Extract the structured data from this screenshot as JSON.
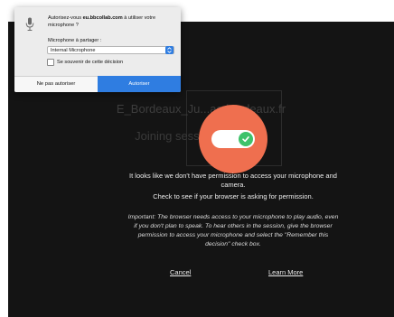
{
  "session": {
    "title": "E_Bordeaux_Ju...ac-bordeaux.fr",
    "subtitle": "Joining sessi... de la forêt"
  },
  "permission": {
    "message_line1": "It looks like we don't have permission to access your microphone and camera.",
    "message_line2": "Check to see if your browser is asking for permission.",
    "important_note": "Important: The browser needs access to your microphone to play audio, even if you don't plan to speak. To hear others in the session, give the browser permission to access your microphone and select the \"Remember this decision\" check box.",
    "cancel_label": "Cancel",
    "learn_more_label": "Learn More"
  },
  "popup": {
    "question_prefix": "Autorisez-vous ",
    "question_domain": "eu.bbcollab.com",
    "question_suffix": " à utiliser votre microphone ?",
    "share_label": "Microphone à partager :",
    "selected_device": "Internal Microphone",
    "remember_label": "Se souvenir de cette décision",
    "deny_label": "Ne pas autoriser",
    "allow_label": "Autoriser"
  },
  "colors": {
    "accent": "#2f7de1",
    "permission_circle": "#ef6f4f",
    "toggle_on": "#3ec26a",
    "background": "#141414"
  },
  "icons": {
    "popup": "microphone-icon",
    "toggle": "check-icon",
    "select": "chevron-updown-icon"
  }
}
